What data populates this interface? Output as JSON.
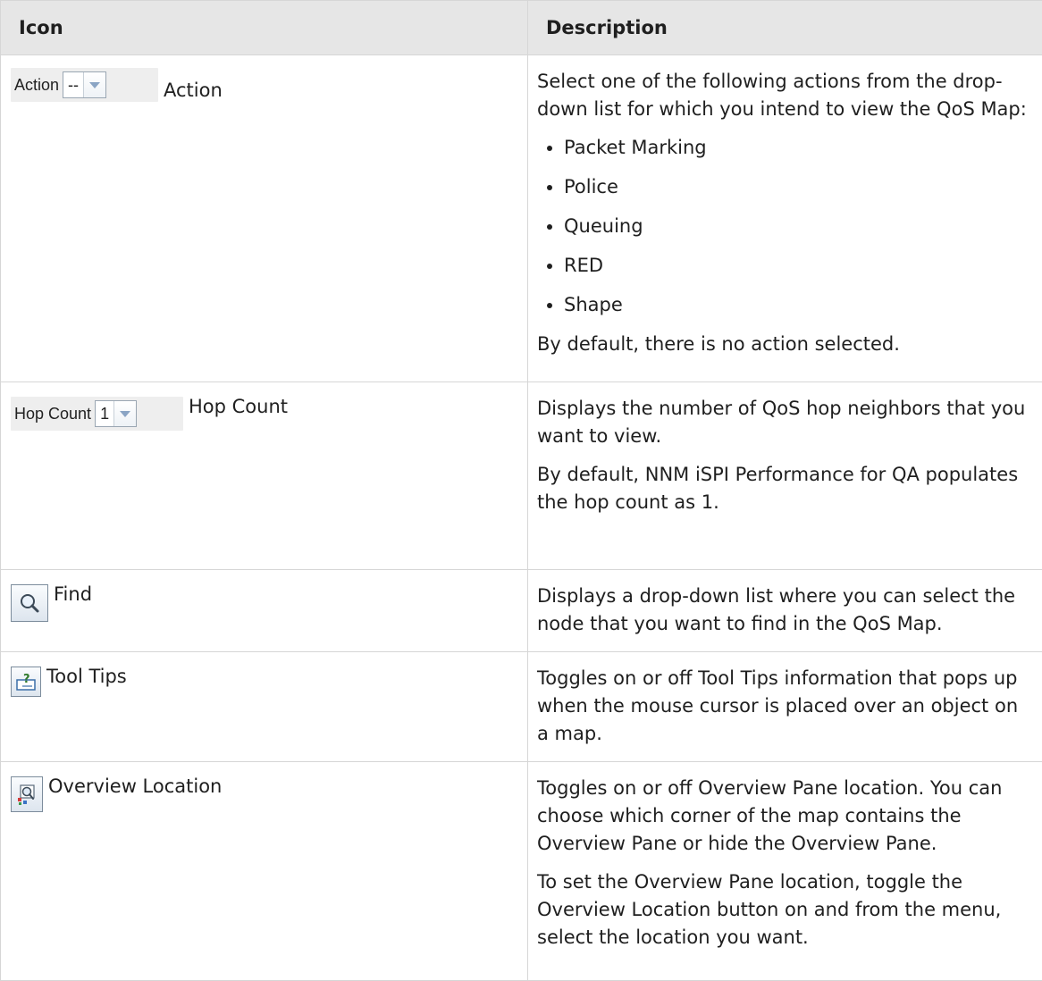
{
  "table": {
    "headers": [
      "Icon",
      "Description"
    ],
    "rows": [
      {
        "widget": {
          "caption": "Action",
          "value": "--"
        },
        "icon_label": "Action",
        "paragraphs_before": [
          "Select one of the following actions from the drop-down list for which you intend to view the QoS Map:"
        ],
        "bullets": [
          "Packet Marking",
          "Police",
          "Queuing",
          "RED",
          "Shape"
        ],
        "paragraphs_after": [
          "By default, there is no action selected."
        ]
      },
      {
        "widget": {
          "caption": "Hop Count",
          "value": "1"
        },
        "icon_label": "Hop Count",
        "paragraphs_before": [
          "Displays the number of QoS hop neighbors that you want to view.",
          "By default, NNM iSPI Performance for QA populates the hop count as 1."
        ]
      },
      {
        "icon": "magnifier-icon",
        "icon_label": "Find",
        "paragraphs_before": [
          "Displays a drop-down list where you can select the node that you want to find in the QoS Map."
        ]
      },
      {
        "icon": "tooltip-question-icon",
        "icon_label": "Tool Tips",
        "paragraphs_before": [
          "Toggles on or off Tool Tips information that pops up when the mouse cursor is placed over an object on a map."
        ]
      },
      {
        "icon": "overview-location-icon",
        "icon_label": "Overview Location",
        "paragraphs_before": [
          "Toggles on or off Overview Pane location. You can choose which corner of the map contains the Overview Pane or hide the Overview Pane.",
          "To set the Overview Pane location, toggle the Overview Location button on and from the menu, select the location you want."
        ]
      }
    ]
  }
}
